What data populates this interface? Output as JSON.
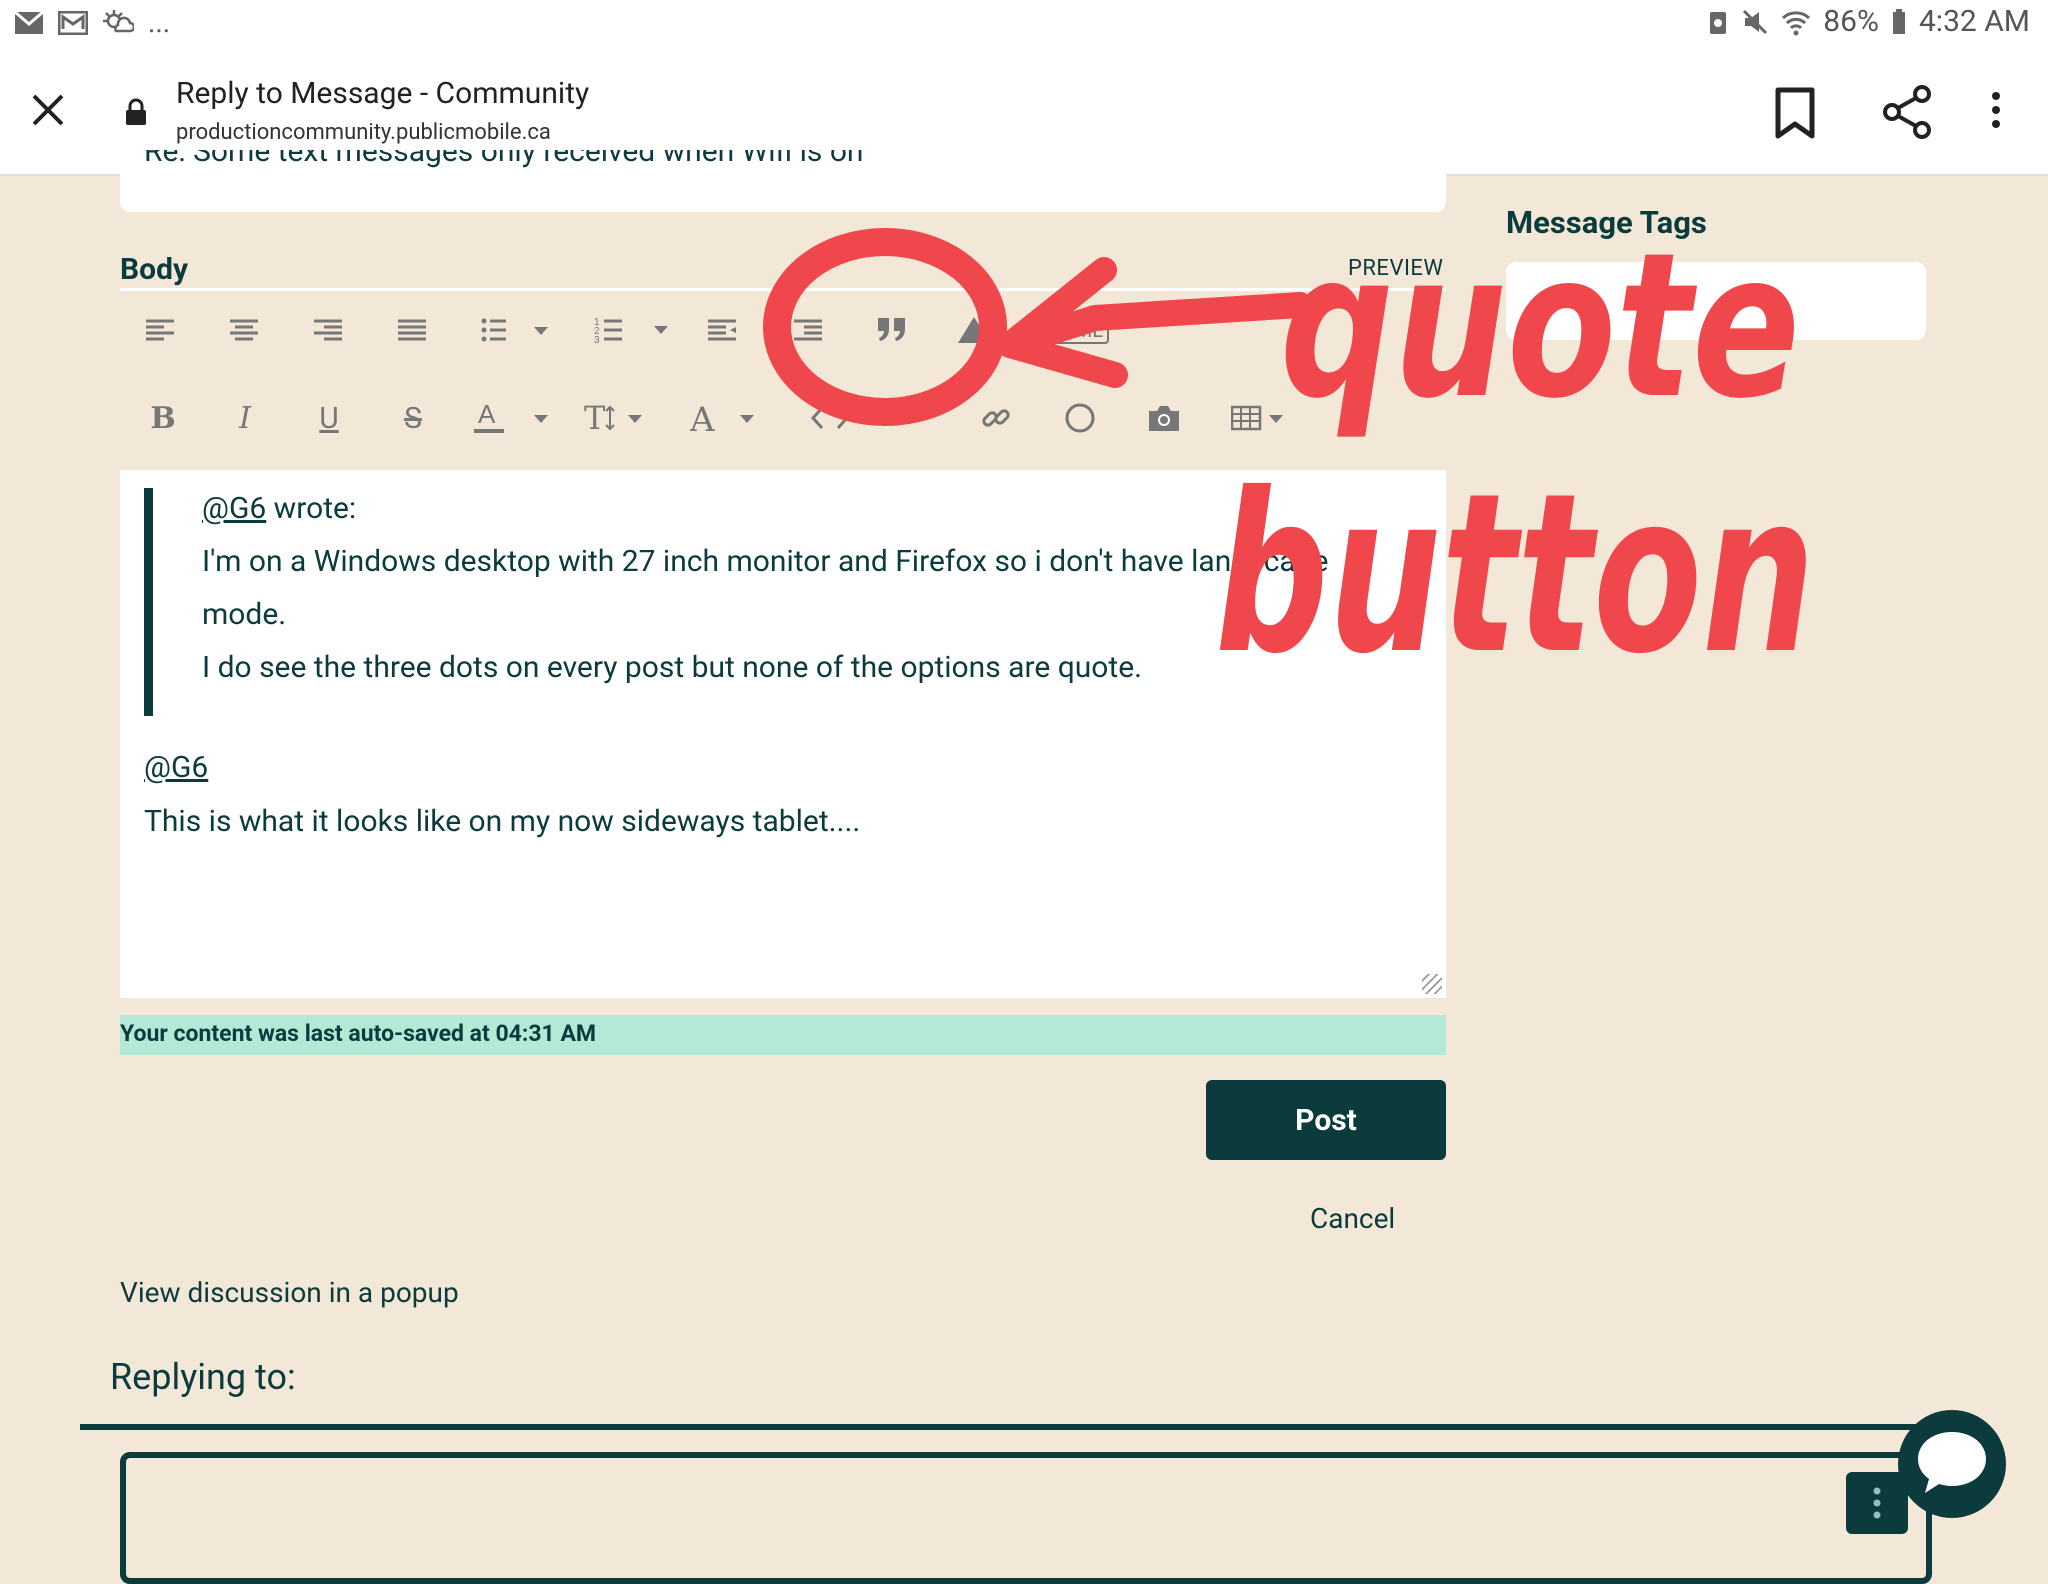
{
  "status_bar": {
    "left_icons": [
      "gmail-icon",
      "mail-icon",
      "weather-icon"
    ],
    "overflow": "...",
    "battery": "86%",
    "time": "4:32 AM",
    "right_icons": [
      "data-saver-icon",
      "mute-icon",
      "wifi-icon",
      "battery-icon"
    ]
  },
  "browser": {
    "page_title": "Reply to Message - Community",
    "url": "productioncommunity.publicmobile.ca"
  },
  "form": {
    "subject_value": "Re: Some text messages only received when Wifi is on",
    "body_label": "Body",
    "preview_label": "PREVIEW",
    "html_label": "HTML",
    "message_tags_label": "Message Tags"
  },
  "toolbar": {
    "row1": [
      "align-left-icon",
      "align-center-icon",
      "align-right-icon",
      "justify-icon",
      "bullet-list-icon",
      "numbered-list-icon",
      "indent-icon",
      "outdent-icon",
      "quote-icon",
      "spoiler-icon",
      "html-icon"
    ],
    "row2": [
      "bold-icon",
      "italic-icon",
      "underline-icon",
      "strikethrough-icon",
      "font-color-icon",
      "font-size-icon",
      "font-family-icon",
      "code-icon",
      "link-icon",
      "emoji-icon",
      "camera-icon",
      "table-icon"
    ]
  },
  "editor": {
    "quote_author": "@G6",
    "quote_wrote": " wrote:",
    "quote_line1": "I'm on a Windows desktop with 27 inch monitor and Firefox so i don't have landscape",
    "quote_line2": "mode.",
    "quote_line3": "I do see the three dots on every post but none of the options are quote.",
    "mention": "@G6",
    "reply_text": "This is what it looks like on my now sideways tablet...."
  },
  "autosave": "Your content was last auto-saved at 04:31 AM",
  "actions": {
    "post": "Post",
    "cancel": "Cancel",
    "popup_link": "View discussion in a popup"
  },
  "replying_to": "Replying to:",
  "annotation": {
    "line1": "quote",
    "line2": "button",
    "color": "#f0474c"
  }
}
